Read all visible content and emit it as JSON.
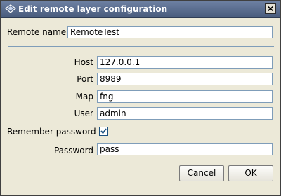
{
  "window": {
    "title": "Edit remote layer configuration"
  },
  "remote_name": {
    "label": "Remote name",
    "value": "RemoteTest"
  },
  "host": {
    "label": "Host",
    "value": "127.0.0.1"
  },
  "port": {
    "label": "Port",
    "value": "8989"
  },
  "map": {
    "label": "Map",
    "value": "fng"
  },
  "user": {
    "label": "User",
    "value": "admin"
  },
  "remember_password": {
    "label": "Remember password",
    "checked": true
  },
  "password": {
    "label": "Password",
    "value": "pass"
  },
  "buttons": {
    "cancel": "Cancel",
    "ok": "OK"
  },
  "icons": {
    "app": "compass-icon",
    "close": "close-icon",
    "check": "check-icon"
  },
  "colors": {
    "titlebar": "#5a6d8f",
    "field_border": "#7f9db9",
    "background": "#ece9d8"
  }
}
